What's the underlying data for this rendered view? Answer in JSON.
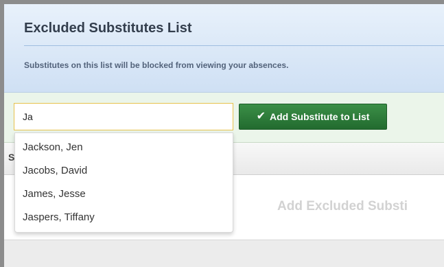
{
  "header": {
    "title": "Excluded Substitutes List",
    "subtitle": "Substitutes on this list will be blocked from viewing your absences."
  },
  "search": {
    "value": "Ja"
  },
  "add_button": {
    "label": "Add Substitute to List",
    "icon": "check-icon"
  },
  "dropdown": {
    "items": [
      {
        "label": "Jackson, Jen"
      },
      {
        "label": "Jacobs, David"
      },
      {
        "label": "James, Jesse"
      },
      {
        "label": "Jaspers, Tiffany"
      }
    ]
  },
  "table": {
    "header_fragment": "S"
  },
  "empty_state": {
    "text": "Add Excluded Substi"
  },
  "colors": {
    "header_bg": "#cfe0f4",
    "toolbar_bg": "#ebf5ea",
    "button_bg": "#2e7d3a",
    "input_border": "#e6c14c"
  }
}
